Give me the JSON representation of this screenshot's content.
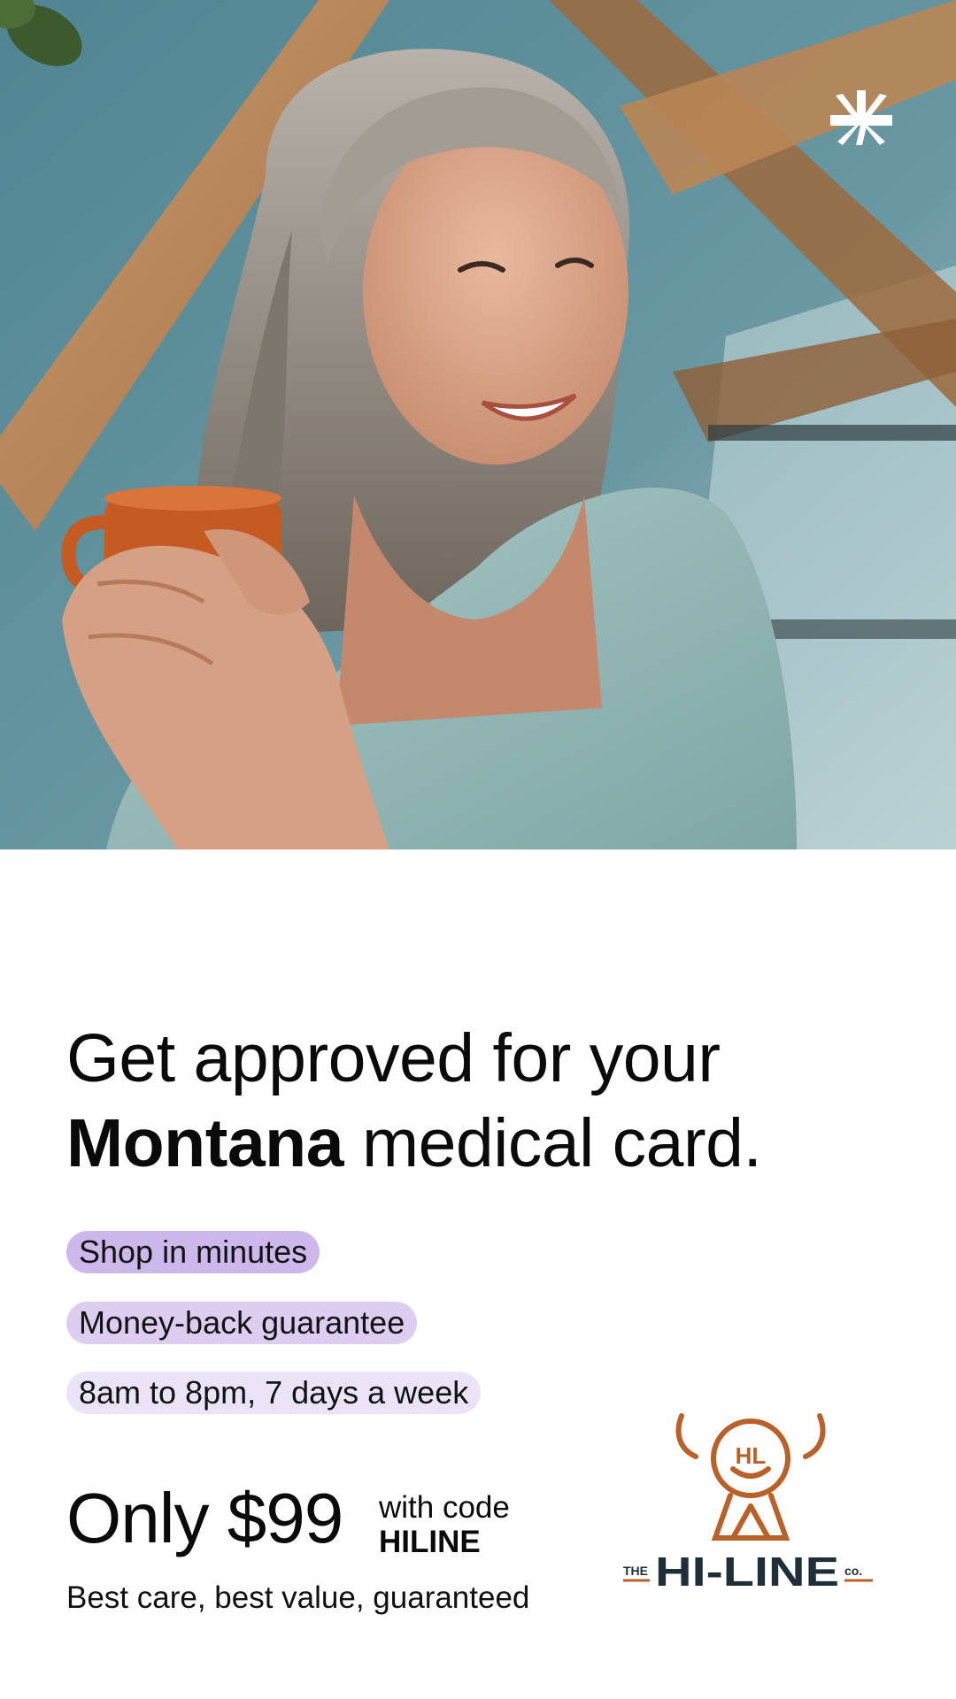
{
  "hero": {
    "image_description_icon": "hero-photo"
  },
  "brand": {
    "icon": "leaf-asterisk-icon",
    "color": "#ffffff"
  },
  "headline": {
    "line1": "Get approved for your",
    "state": "Montana",
    "line2_rest": " medical card."
  },
  "features": [
    {
      "label": "Shop in minutes",
      "color": "#cdb8ec"
    },
    {
      "label": "Money-back guarantee",
      "color": "#dccdf1"
    },
    {
      "label": "8am to 8pm, 7 days a week",
      "color": "#ebe3f7"
    }
  ],
  "offer": {
    "price_text": "Only $99",
    "code_prefix": "with code",
    "code": "HILINE",
    "tagline": "Best care, best value, guaranteed"
  },
  "partner": {
    "monogram": "HL",
    "the": "THE",
    "name": "HI-LINE",
    "suffix": "co.",
    "accent_color": "#b8612a",
    "text_color": "#1f2f38"
  }
}
